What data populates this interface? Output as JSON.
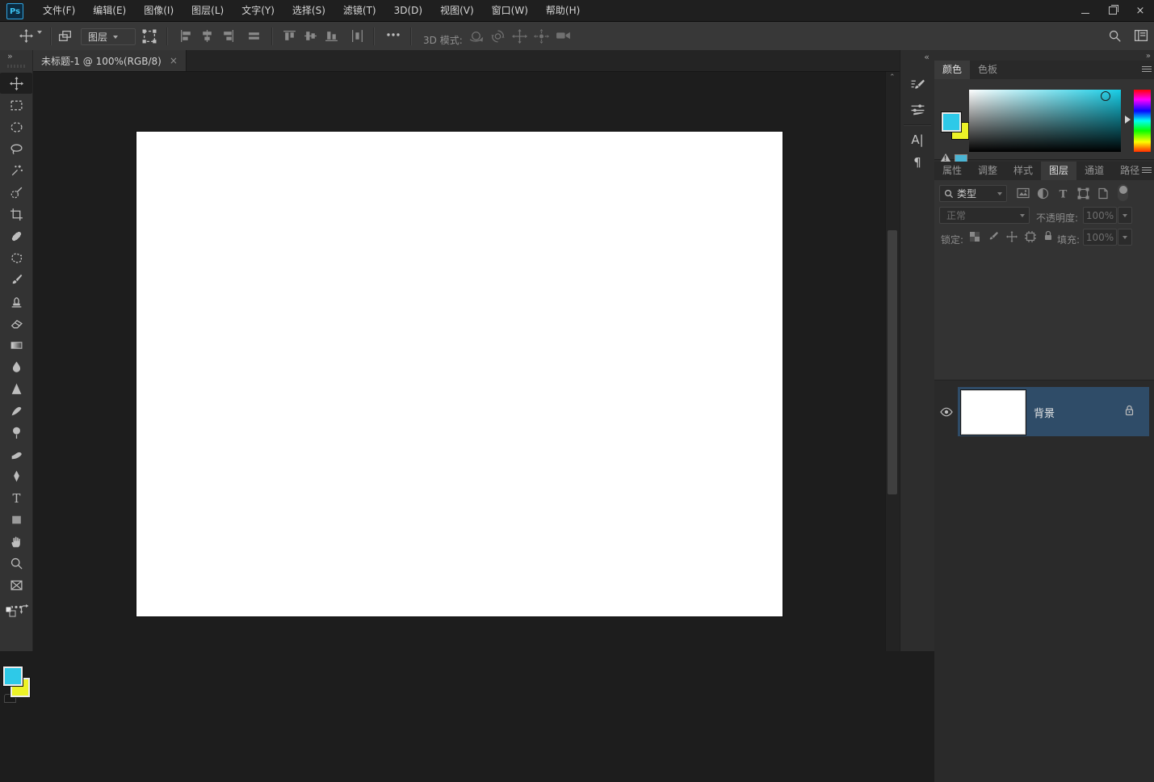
{
  "titlebar": {
    "logo_text": "Ps",
    "menu": [
      "文件(F)",
      "编辑(E)",
      "图像(I)",
      "图层(L)",
      "文字(Y)",
      "选择(S)",
      "滤镜(T)",
      "3D(D)",
      "视图(V)",
      "窗口(W)",
      "帮助(H)"
    ]
  },
  "options_bar": {
    "layer_select_value": "图层",
    "mode_3d_label": "3D 模式:"
  },
  "document": {
    "tab_title": "未标题-1 @ 100%(RGB/8)",
    "close_glyph": "×"
  },
  "glyphs": {
    "collapse_left": "«",
    "collapse_right": "»",
    "scroll_up": "⌃",
    "paragraph": "¶",
    "character": "A|"
  },
  "toolbar": {
    "tools": [
      "move",
      "rectangular-marquee",
      "elliptical-marquee",
      "lasso",
      "magic-wand",
      "quick-selection",
      "crop",
      "spot-healing-brush",
      "patch",
      "brush",
      "clone-stamp",
      "eraser",
      "gradient",
      "blur",
      "sharpen",
      "smudge",
      "dodge",
      "burn",
      "pen",
      "type",
      "rectangle",
      "hand",
      "zoom",
      "frame"
    ],
    "selected_tool": "move",
    "foreground_color": "#2ec9e8",
    "background_color": "#ecf227"
  },
  "color_panel": {
    "tabs": [
      "颜色",
      "色板"
    ],
    "active_tab": "颜色",
    "foreground_color": "#2ec9e8",
    "background_color": "#ecf227",
    "out_of_gamut_swatch": "#4ab5d4"
  },
  "dock_icons": [
    "brush-presets",
    "brush-settings",
    "character",
    "paragraph"
  ],
  "layers_panel": {
    "tabs": [
      "属性",
      "调整",
      "样式",
      "图层",
      "通道",
      "路径"
    ],
    "active_tab": "图层",
    "filter_type_label": "类型",
    "blend_mode_value": "正常",
    "opacity_label": "不透明度:",
    "opacity_value": "100%",
    "lock_label": "锁定:",
    "fill_label": "填充:",
    "fill_value": "100%",
    "layers": [
      {
        "name": "背景",
        "visible": true,
        "locked": true,
        "selected": true
      }
    ]
  },
  "colors": {
    "selected_layer_row": "#2f4c68",
    "panel_background": "#333333",
    "canvas_background": "#1d1d1d",
    "titlebar_background": "#1f1f1f"
  }
}
